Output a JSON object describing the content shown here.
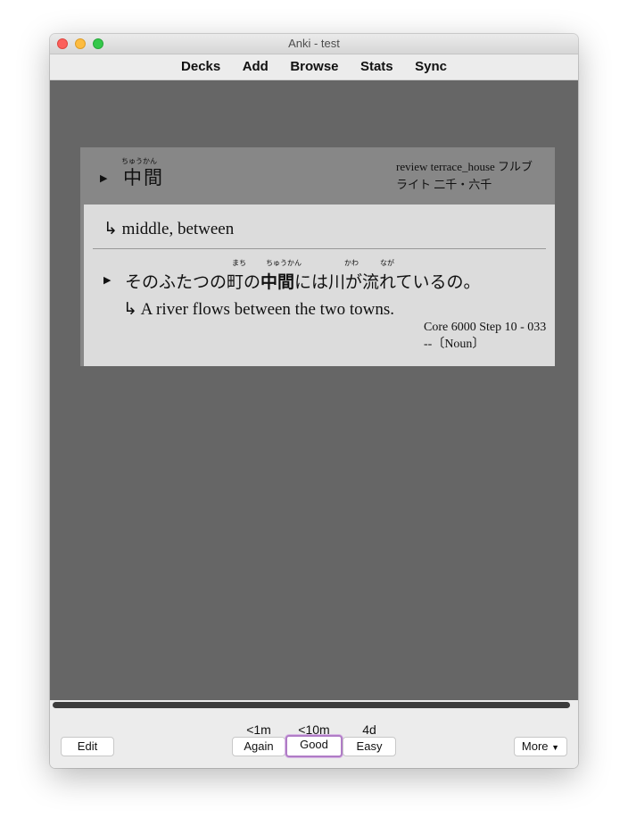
{
  "window": {
    "title": "Anki - test"
  },
  "toolbar": {
    "decks": "Decks",
    "add": "Add",
    "browse": "Browse",
    "stats": "Stats",
    "sync": "Sync"
  },
  "card": {
    "word": "中間",
    "word_reading": "ちゅうかん",
    "tags_line1": "review terrace_house フルブ",
    "tags_line2": "ライト 二千・六千",
    "meaning": "middle, between",
    "sentence_pre": "そのふたつの町の",
    "sentence_bold": "中間",
    "sentence_post": "には川が流れているの。",
    "ruby_machi": "まち",
    "ruby_chuukan": "ちゅうかん",
    "ruby_kawa": "かわ",
    "ruby_naga": "なが",
    "translation": "A river flows between the two towns.",
    "source_line1": "Core 6000 Step 10 - 033",
    "source_line2": "--〔Noun〕"
  },
  "icons": {
    "expand": "play-triangle-icon",
    "answer_arrow": "return-arrow-icon"
  },
  "bottom": {
    "edit": "Edit",
    "again_interval": "<1m",
    "again": "Again",
    "good_interval": "<10m",
    "good": "Good",
    "easy_interval": "4d",
    "easy": "Easy",
    "more": "More"
  },
  "colors": {
    "content_bg": "#666666",
    "front_bg": "#878787",
    "back_bg": "#dcdcdc",
    "good_focus": "#b07cc6"
  }
}
